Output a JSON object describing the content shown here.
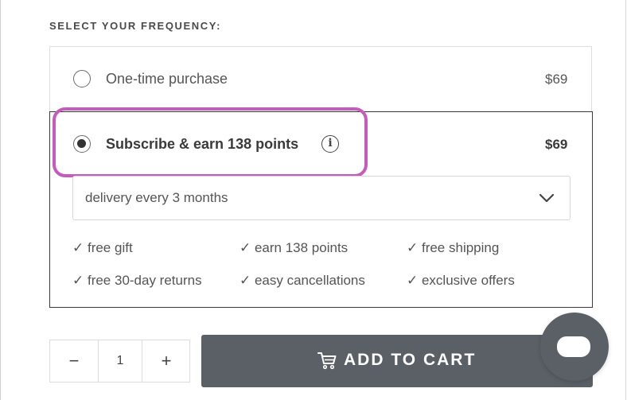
{
  "heading": "SELECT YOUR FREQUENCY:",
  "options": [
    {
      "label": "One-time purchase",
      "price": "$69",
      "selected": false
    },
    {
      "label": "Subscribe & earn 138 points",
      "price": "$69",
      "selected": true
    }
  ],
  "info_icon_glyph": "i",
  "delivery_select": {
    "value": "delivery every 3 months"
  },
  "benefits": [
    "✓ free gift",
    "✓ earn 138 points",
    "✓ free shipping",
    "✓ free 30-day returns",
    "✓ easy cancellations",
    "✓ exclusive offers"
  ],
  "quantity": {
    "minus": "−",
    "value": "1",
    "plus": "+"
  },
  "add_to_cart": {
    "label": "ADD TO CART"
  },
  "colors": {
    "highlight": "#c65bbd",
    "button": "#5b5f66"
  },
  "icons": [
    "info-icon",
    "chevron-down-icon",
    "cart-icon",
    "chat-icon"
  ]
}
